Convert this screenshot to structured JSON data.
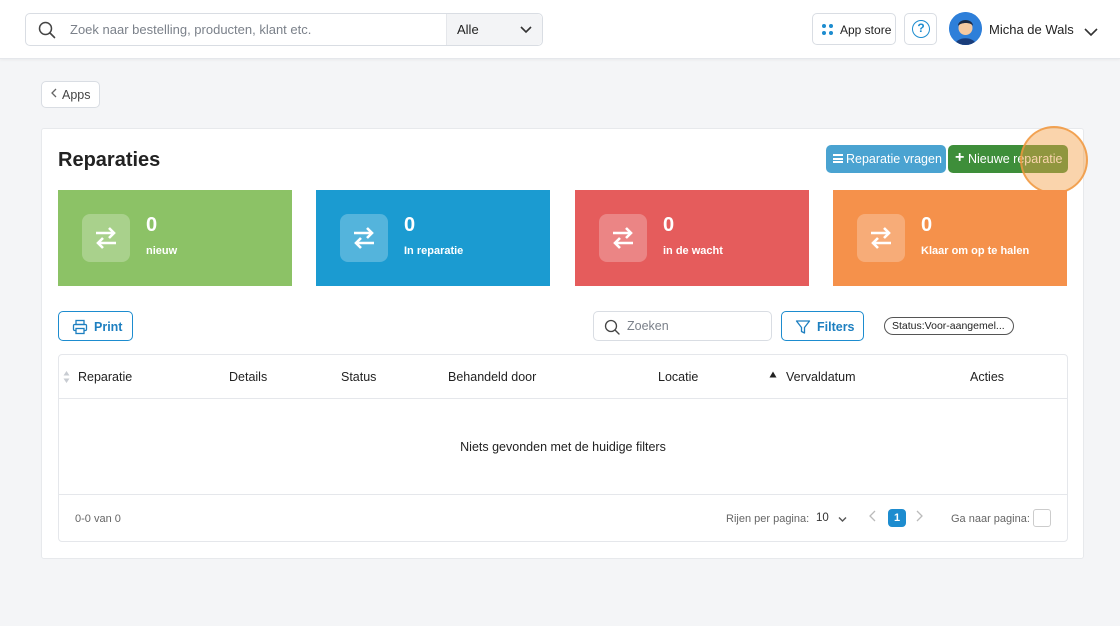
{
  "header": {
    "search_placeholder": "Zoek naar bestelling, producten, klant etc.",
    "search_scope": "Alle",
    "app_store_label": "App store",
    "help_label": "?",
    "user_name": "Micha de Wals"
  },
  "nav": {
    "back_label": "Apps"
  },
  "page": {
    "title": "Reparaties",
    "ask_repair_label": "Reparatie vragen",
    "new_repair_label": "Nieuwe reparatie"
  },
  "stats": [
    {
      "value": "0",
      "label": "nieuw",
      "color": "#8cc266"
    },
    {
      "value": "0",
      "label": "In reparatie",
      "color": "#1b9bd1"
    },
    {
      "value": "0",
      "label": "in de wacht",
      "color": "#e55c5c"
    },
    {
      "value": "0",
      "label": "Klaar om op te halen",
      "color": "#f5914b"
    }
  ],
  "toolbar": {
    "print_label": "Print",
    "search_placeholder": "Zoeken",
    "filters_label": "Filters",
    "active_filter": "Status:Voor-aangemel..."
  },
  "table": {
    "columns": [
      "Reparatie",
      "Details",
      "Status",
      "Behandeld door",
      "Locatie",
      "Vervaldatum",
      "Acties"
    ],
    "empty_message": "Niets gevonden met de huidige filters",
    "count_text": "0-0 van 0",
    "rows_per_page_label": "Rijen per pagina:",
    "rows_per_page": "10",
    "current_page": "1",
    "goto_label": "Ga naar pagina:"
  },
  "colors": {
    "accent": "#1d8ccf",
    "new_button": "#3e8e3a",
    "ask_button": "#4aa3d1"
  }
}
